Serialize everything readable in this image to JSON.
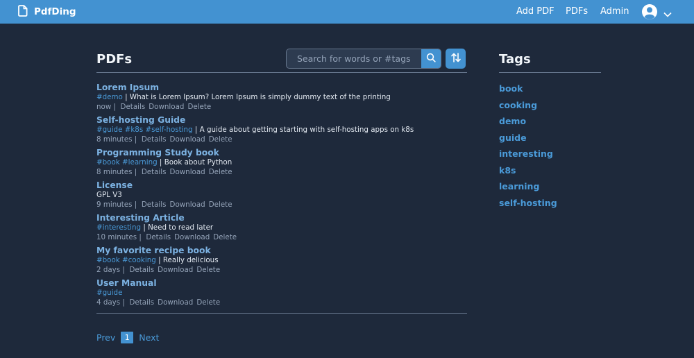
{
  "app": {
    "name": "PdfDing"
  },
  "nav": {
    "add_pdf": "Add PDF",
    "pdfs": "PDFs",
    "admin": "Admin"
  },
  "main": {
    "heading": "PDFs",
    "search_placeholder": "Search for words or #tags",
    "pdfs": [
      {
        "title": "Lorem Ipsum",
        "tags": "#demo",
        "description": "What is Lorem Ipsum? Lorem Ipsum is simply dummy text of the printing",
        "age": "now",
        "actions": [
          "Details",
          "Download",
          "Delete"
        ]
      },
      {
        "title": "Self-hosting Guide",
        "tags": "#guide #k8s #self-hosting",
        "description": "A guide about getting starting with self-hosting apps on k8s",
        "age": "8 minutes",
        "actions": [
          "Details",
          "Download",
          "Delete"
        ]
      },
      {
        "title": "Programming Study book",
        "tags": "#book #learning",
        "description": "Book about Python",
        "age": "8 minutes",
        "actions": [
          "Details",
          "Download",
          "Delete"
        ]
      },
      {
        "title": "License",
        "tags": "",
        "description": "GPL V3",
        "age": "9 minutes",
        "actions": [
          "Details",
          "Download",
          "Delete"
        ]
      },
      {
        "title": "Interesting Article",
        "tags": "#interesting",
        "description": "Need to read later",
        "age": "10 minutes",
        "actions": [
          "Details",
          "Download",
          "Delete"
        ]
      },
      {
        "title": "My favorite recipe book",
        "tags": "#book #cooking",
        "description": "Really delicious",
        "age": "2 days",
        "actions": [
          "Details",
          "Download",
          "Delete"
        ]
      },
      {
        "title": "User Manual",
        "tags": "#guide",
        "description": "",
        "age": "4 days",
        "actions": [
          "Details",
          "Download",
          "Delete"
        ]
      }
    ],
    "pagination": {
      "prev": "Prev",
      "current": "1",
      "next": "Next"
    }
  },
  "sidebar": {
    "heading": "Tags",
    "tags": [
      "book",
      "cooking",
      "demo",
      "guide",
      "interesting",
      "k8s",
      "learning",
      "self-hosting"
    ]
  },
  "colors": {
    "topbar": "#4392d1",
    "background": "#1e293b",
    "link": "#4a9ad8",
    "title": "#7cb2e2"
  }
}
